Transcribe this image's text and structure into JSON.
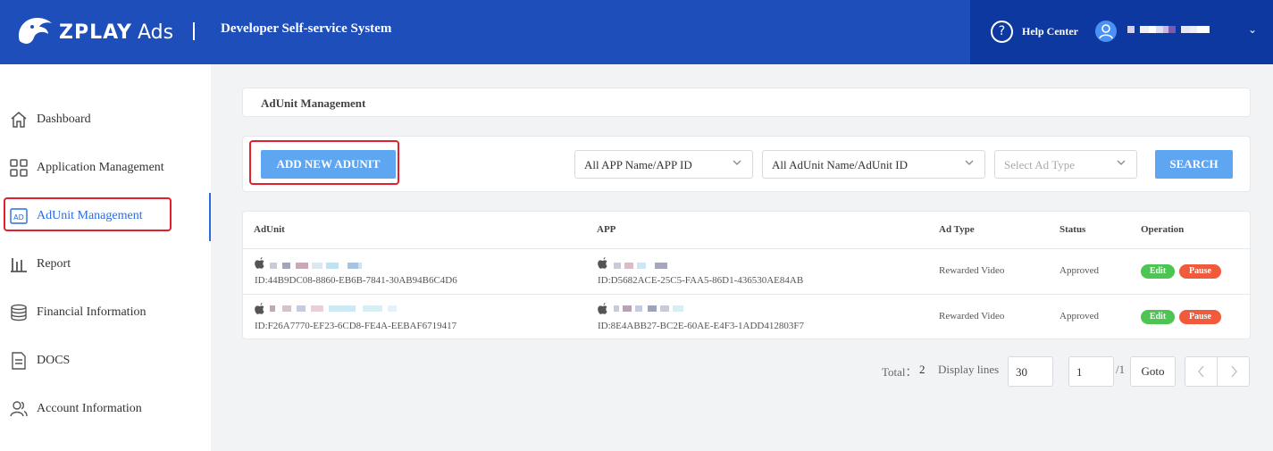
{
  "header": {
    "logo_text": "ZPLAY",
    "logo_suffix": "Ads",
    "system_title": "Developer Self-service System",
    "help_label": "Help Center",
    "help_icon": "question-circle-icon",
    "user_icon": "user-avatar-icon",
    "colors": {
      "main": "#1d4eb9",
      "right": "#0c38a0"
    }
  },
  "sidebar": {
    "items": [
      {
        "label": "Dashboard",
        "icon": "home-icon"
      },
      {
        "label": "Application Management",
        "icon": "grid-icon"
      },
      {
        "label": "AdUnit Management",
        "icon": "ad-icon",
        "active": true
      },
      {
        "label": "Report",
        "icon": "bar-chart-icon"
      },
      {
        "label": "Financial Information",
        "icon": "coins-icon"
      },
      {
        "label": "DOCS",
        "icon": "document-icon"
      },
      {
        "label": "Account Information",
        "icon": "users-icon"
      }
    ]
  },
  "main": {
    "page_title": "AdUnit Management",
    "add_button_label": "ADD NEW ADUNIT",
    "filters": {
      "app_select": "All APP Name/APP ID",
      "adunit_select": "All AdUnit Name/AdUnit ID",
      "adtype_placeholder": "Select Ad Type",
      "search_label": "SEARCH"
    },
    "table": {
      "columns": [
        "AdUnit",
        "APP",
        "Ad Type",
        "Status",
        "Operation"
      ],
      "rows": [
        {
          "adunit_id": "ID:44B9DC08-8860-EB6B-7841-30AB94B6C4D6",
          "app_id": "ID:D5682ACE-25C5-FAA5-86D1-436530AE84AB",
          "ad_type": "Rewarded Video",
          "status": "Approved",
          "edit_label": "Edit",
          "pause_label": "Pause"
        },
        {
          "adunit_id": "ID:F26A7770-EF23-6CD8-FE4A-EEBAF6719417",
          "app_id": "ID:8E4ABB27-BC2E-60AE-E4F3-1ADD412803F7",
          "ad_type": "Rewarded Video",
          "status": "Approved",
          "edit_label": "Edit",
          "pause_label": "Pause"
        }
      ]
    },
    "pagination": {
      "total_label": "Total：",
      "total_value": "2",
      "display_lines_label": "Display lines",
      "display_lines_value": "30",
      "page_value": "1",
      "page_total": "/1",
      "goto_label": "Goto"
    }
  }
}
